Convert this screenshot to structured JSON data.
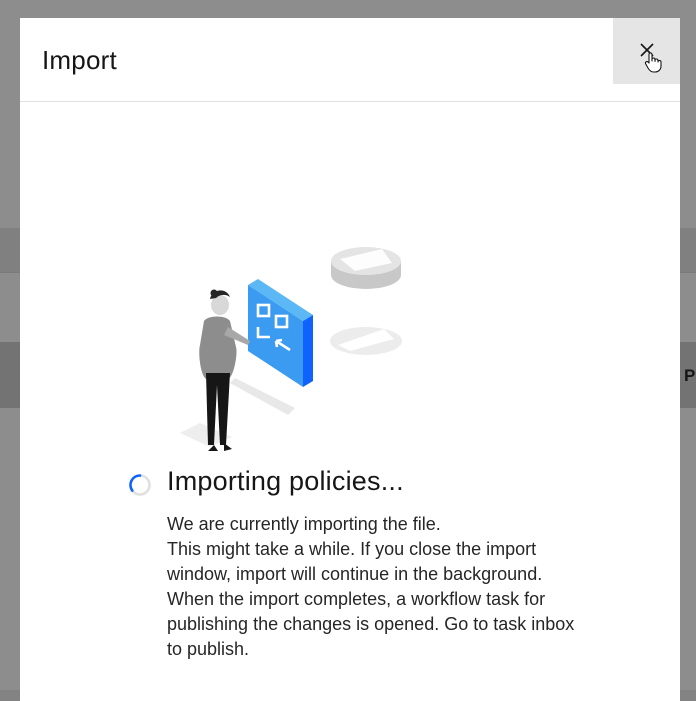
{
  "background": {
    "edge_text": "P"
  },
  "dialog": {
    "title": "Import",
    "close_label": "Close"
  },
  "status": {
    "title": "Importing policies...",
    "paragraphs": [
      "We are currently importing the file.",
      "This might take a while. If you close the import window, import will continue in the background.",
      "When the import completes, a workflow task for publishing the changes is opened. Go to task inbox to publish."
    ]
  },
  "colors": {
    "accent": "#0f62fe",
    "overlay": "#8d8d8d",
    "close_bg": "#e5e5e5",
    "text": "#161616"
  },
  "icons": {
    "close": "close-icon",
    "cursor": "hand-pointer-icon",
    "spinner": "loading-spinner-icon"
  }
}
